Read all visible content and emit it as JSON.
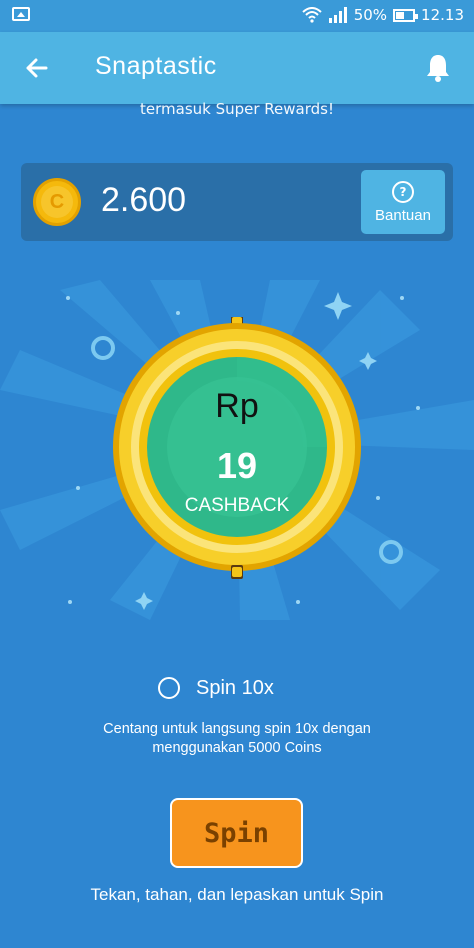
{
  "status_bar": {
    "battery_percent": "50%",
    "time": "12.13"
  },
  "header": {
    "title": "Snaptastic",
    "subtitle": "termasuk Super Rewards!"
  },
  "coins": {
    "balance": "2.600",
    "coin_symbol": "C",
    "help_label": "Bantuan"
  },
  "wheel": {
    "currency": "Rp",
    "amount": "19",
    "label": "CASHBACK"
  },
  "spin10": {
    "label": "Spin 10x",
    "checked": false,
    "description_line1": "Centang untuk langsung spin 10x dengan",
    "description_line2": "menggunakan 5000 Coins"
  },
  "spin_button": {
    "label": "Spin"
  },
  "hint": "Tekan, tahan, dan lepaskan untuk Spin",
  "colors": {
    "background": "#2e86d1",
    "app_bar": "#4fb4e3",
    "spin_button": "#f7941d",
    "wheel_ring": "#f5c518",
    "wheel_center": "#2fb88a"
  }
}
